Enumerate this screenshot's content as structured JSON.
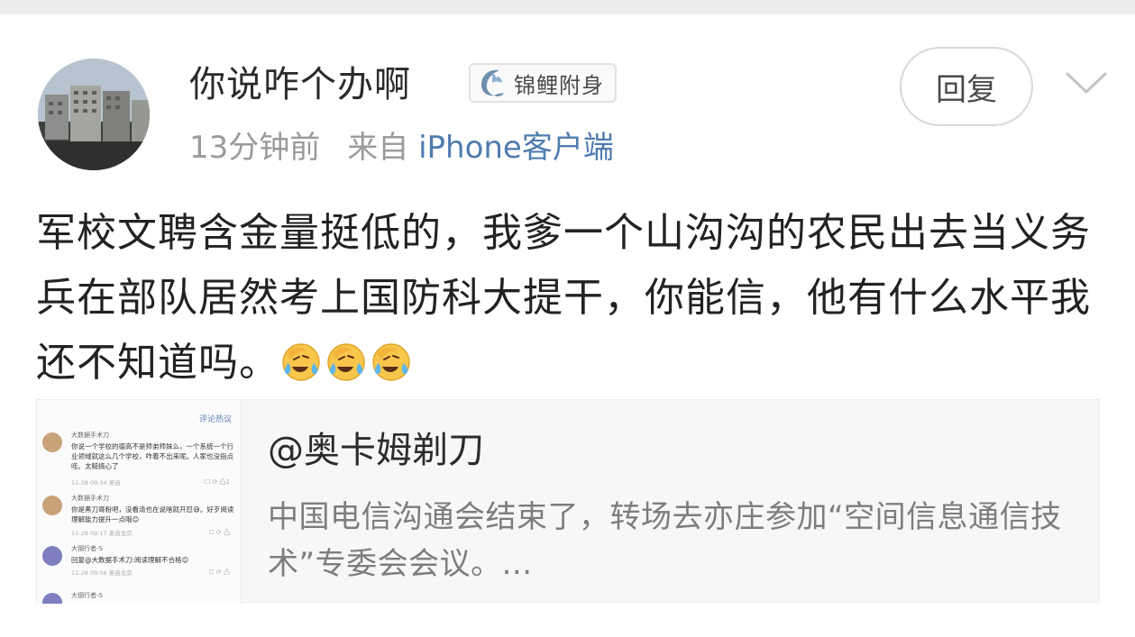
{
  "post": {
    "username": "你说咋个办啊",
    "badge": {
      "icon": "koi-fish-icon",
      "label": "锦鲤附身"
    },
    "time": "13分钟前",
    "source_prefix": "来自",
    "source_client": "iPhone客户端",
    "reply_label": "回复",
    "text": "军校文聘含金量挺低的，我爹一个山沟沟的农民出去当义务兵在部队居然考上国防科大提干，你能信，他有什么水平我还不知道吗。",
    "emojis": [
      "laugh-cry-emoji",
      "laugh-cry-emoji",
      "laugh-cry-emoji"
    ]
  },
  "quoted": {
    "user": "@奥卡姆剃刀",
    "text": "中国电信沟通会结束了，转场去亦庄参加“空间信息通信技术”专委会会议。...",
    "thumbnail": {
      "header": "评论热议",
      "comments": [
        {
          "name": "大数据手术刀",
          "body": "你说一个学校的德高不是师弟师妹么，一个系统一个行业领域就这么几个学校，咋着不出来呢。人家也没指点哇。太糙搞心了",
          "time": "11-28 09:34 来自",
          "icons": "☐ ⟳ 凸1"
        },
        {
          "name": "大数据手术刀",
          "body": "你是黑刀哥粉吧，没看清也在说啥就开怼😅。好歹阅读理解能力提升一点哦😊",
          "time": "11-28 09:17 来自北京",
          "icons": "☐ ⟳ 凸"
        },
        {
          "name": "大钢行者-S",
          "body": "回复@大数据手术刀:阅读理解不合格😊",
          "mention": "@大数据手术刀",
          "time": "11-28 09:56 来自北京",
          "icons": "☐ ⟳ 凸"
        },
        {
          "name": "大钢行者-S",
          "body": "",
          "time": "",
          "icons": ""
        }
      ]
    }
  },
  "colors": {
    "link": "#4f7cae",
    "meta_gray": "#9a9a9a",
    "quote_gray": "#7d7d7d",
    "card_bg": "#f7f7f7"
  }
}
